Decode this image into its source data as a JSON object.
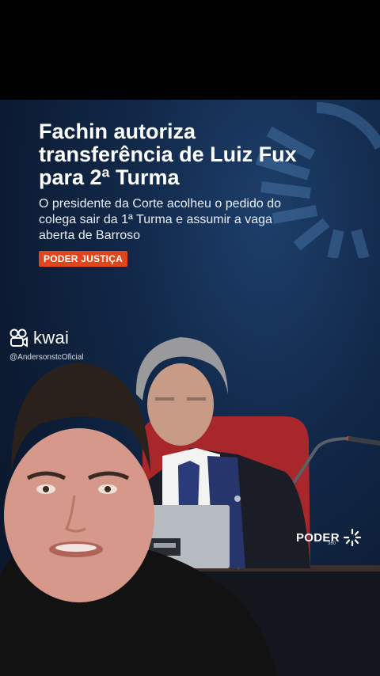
{
  "headline": "Fachin autoriza transferência de Luiz Fux para 2ª Turma",
  "subtitle": "O presidente da Corte acolheu o pedido do colega sair da 1ª Turma e assumir a vaga aberta de Barroso",
  "tag": "PODER JUSTIÇA",
  "kwai": {
    "wordmark": "kwai",
    "handle": "@AndersonstcOficial",
    "icon": "kwai-logo-icon"
  },
  "broadcaster": {
    "wordmark": "PODER",
    "number": "360",
    "icon": "sunburst-icon"
  },
  "colors": {
    "tag_background": "#e0451c",
    "background": "#0c1b33",
    "chair": "#a8272b"
  }
}
